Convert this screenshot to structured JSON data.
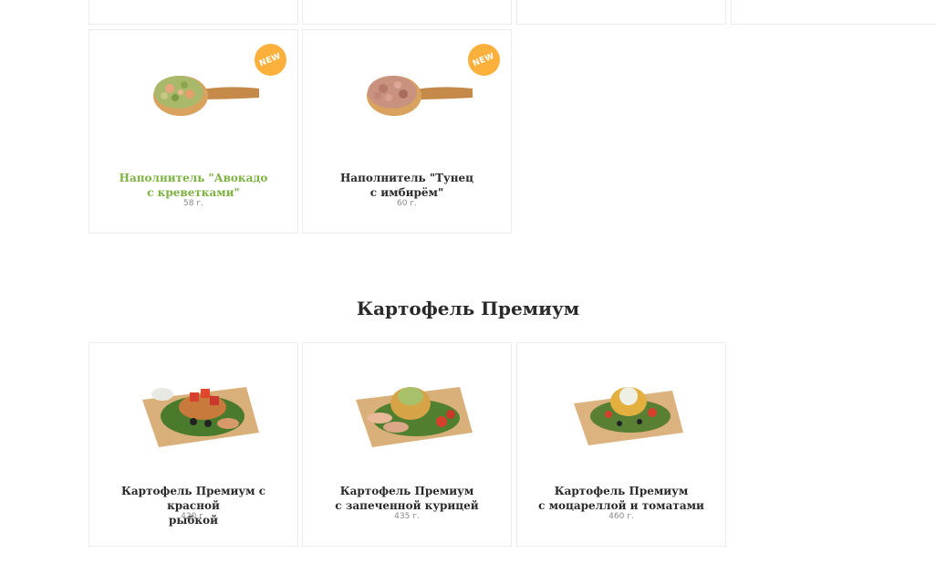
{
  "top_products": [
    {
      "title_lines": [
        "Наполнитель \"Авокадо",
        "с креветками\""
      ],
      "weight": "58 г.",
      "badge": "NEW",
      "highlight": true,
      "color": "#7cb342"
    },
    {
      "title_lines": [
        "Наполнитель \"Тунец",
        "с имбирём\""
      ],
      "weight": "60 г.",
      "badge": "NEW",
      "highlight": false
    }
  ],
  "section": {
    "title": "Картофель Премиум"
  },
  "premium_products": [
    {
      "title_lines": [
        "Картофель Премиум с красной",
        "рыбкой"
      ],
      "weight": "420 г."
    },
    {
      "title_lines": [
        "Картофель Премиум",
        "с запеченной курицей"
      ],
      "weight": "435 г."
    },
    {
      "title_lines": [
        "Картофель Премиум",
        "с моцареллой и томатами"
      ],
      "weight": "460 г."
    }
  ],
  "colors": {
    "badge": "#fbb03b",
    "accent": "#7cb342",
    "border": "#ececec"
  }
}
